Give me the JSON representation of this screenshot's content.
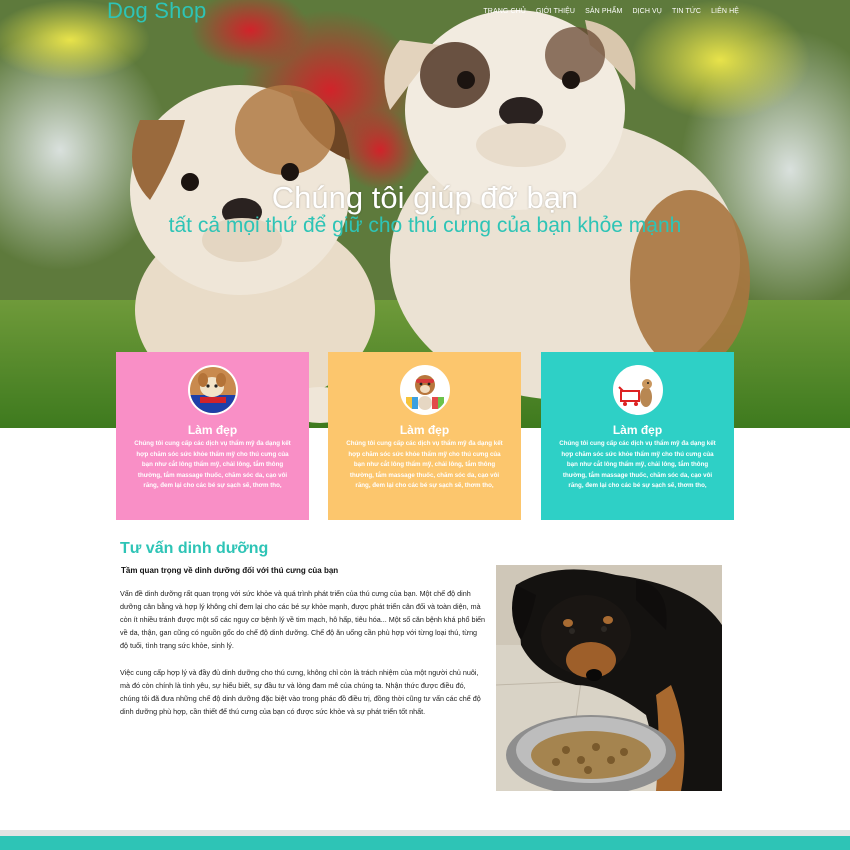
{
  "brand": {
    "logo": "Dog Shop"
  },
  "nav": {
    "items": [
      "TRANG CHỦ",
      "GIỚI THIỆU",
      "SẢN PHẨM",
      "DỊCH VỤ",
      "TIN TỨC",
      "LIÊN HỆ"
    ]
  },
  "hero": {
    "title": "Chúng tôi giúp đỡ bạn",
    "subtitle": "tất cả mọi thứ để giữ cho thú cưng của bạn khỏe mạnh"
  },
  "cards": [
    {
      "title": "Làm đẹp",
      "text": "Chúng tôi cung cấp các dịch vụ thẩm mỹ đa dạng kết hợp chăm sóc sức khỏe thẩm mỹ cho thú cưng của bạn như cắt lông thẩm mỹ, chải lông, tắm thông thường, tắm massage thuốc, chăm sóc da, cạo vôi răng, đem lại cho các bé sự sạch sẽ, thơm tho,",
      "color": "#f98fc6"
    },
    {
      "title": "Làm đẹp",
      "text": "Chúng tôi cung cấp các dịch vụ thẩm mỹ đa dạng kết hợp chăm sóc sức khỏe thẩm mỹ cho thú cưng của bạn như cắt lông thẩm mỹ, chải lông, tắm thông thường, tắm massage thuốc, chăm sóc da, cạo vôi răng, đem lại cho các bé sự sạch sẽ, thơm tho,",
      "color": "#fcc66d"
    },
    {
      "title": "Làm đẹp",
      "text": "Chúng tôi cung cấp các dịch vụ thẩm mỹ đa dạng kết hợp chăm sóc sức khỏe thẩm mỹ cho thú cưng của bạn như cắt lông thẩm mỹ, chải lông, tắm thông thường, tắm massage thuốc, chăm sóc da, cạo vôi răng, đem lại cho các bé sự sạch sẽ, thơm tho,",
      "color": "#2ed0c6"
    }
  ],
  "nutrition": {
    "title": "Tư vấn dinh dưỡng",
    "subtitle": "Tầm quan trọng về dinh dưỡng đối với thú cưng của bạn",
    "paragraphs": [
      "Vấn đề dinh dưỡng rất quan trọng với sức khỏe và quá trình phát triển của thú cưng của bạn. Một chế độ dinh dưỡng cân bằng và hợp lý không chỉ đem lại cho các bé sự khỏe mạnh, được phát triển cân đối và toàn diện, mà còn ít nhiều tránh được một số các nguy cơ bệnh lý về tim mạch, hô hấp, tiêu hóa... Một số căn bệnh khá phổ biến về da, thận, gan cũng có nguồn gốc do chế độ dinh dưỡng. Chế độ ăn uống cần phù hợp với từng loại thú, từng độ tuổi, tình trạng sức khỏe, sinh lý.",
      "Việc cung cấp hợp lý và đầy đủ dinh dưỡng cho thú cưng, không chỉ còn là trách nhiệm của một người chủ nuôi, mà đó còn chính là tình yêu, sự hiểu biết, sự đầu tư và lòng đam mê của chúng ta. Nhận thức được điều đó, chúng tôi đã đưa những chế độ dinh dưỡng đặc biệt vào trong phác đồ điều trị, đồng thời cũng tư vấn các chế độ dinh dưỡng phù hợp, cần thiết để thú cưng của bạn có được sức khỏe và sự phát triển tốt nhất."
    ]
  },
  "colors": {
    "accent": "#2ec4b6",
    "footer_gray": "#e3e3e3"
  }
}
